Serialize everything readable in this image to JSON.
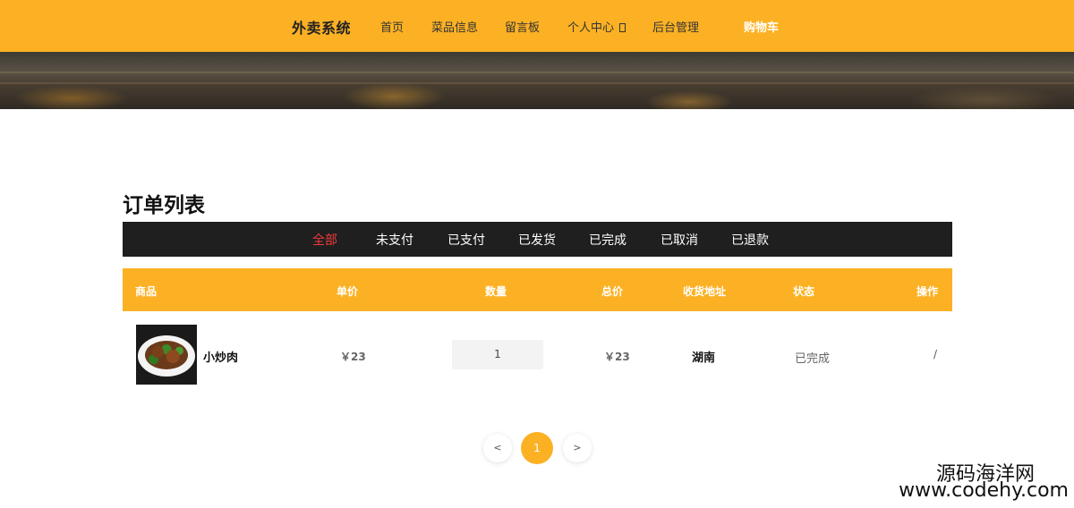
{
  "navbar": {
    "brand": "外卖系统",
    "items": [
      {
        "label": "首页"
      },
      {
        "label": "菜品信息"
      },
      {
        "label": "留言板"
      },
      {
        "label": "个人中心"
      },
      {
        "label": "后台管理"
      },
      {
        "label": "购物车"
      }
    ]
  },
  "page": {
    "title": "订单列表"
  },
  "tabs": [
    {
      "label": "全部",
      "active": true
    },
    {
      "label": "未支付"
    },
    {
      "label": "已支付"
    },
    {
      "label": "已发货"
    },
    {
      "label": "已完成"
    },
    {
      "label": "已取消"
    },
    {
      "label": "已退款"
    }
  ],
  "table": {
    "headers": [
      "商品",
      "单价",
      "数量",
      "总价",
      "收货地址",
      "状态",
      "操作"
    ],
    "rows": [
      {
        "product": "小炒肉",
        "unit_price": "￥23",
        "quantity": "1",
        "total": "￥23",
        "address": "湖南",
        "status": "已完成",
        "action": "/"
      }
    ]
  },
  "pagination": {
    "prev": "<",
    "current": "1",
    "next": ">"
  },
  "watermark": {
    "line1": "源码海洋网",
    "line2": "www.codehy.com"
  },
  "colors": {
    "accent": "#fcb124",
    "tab_bar": "#1f1f1f",
    "active_tab": "#f23a3a"
  }
}
